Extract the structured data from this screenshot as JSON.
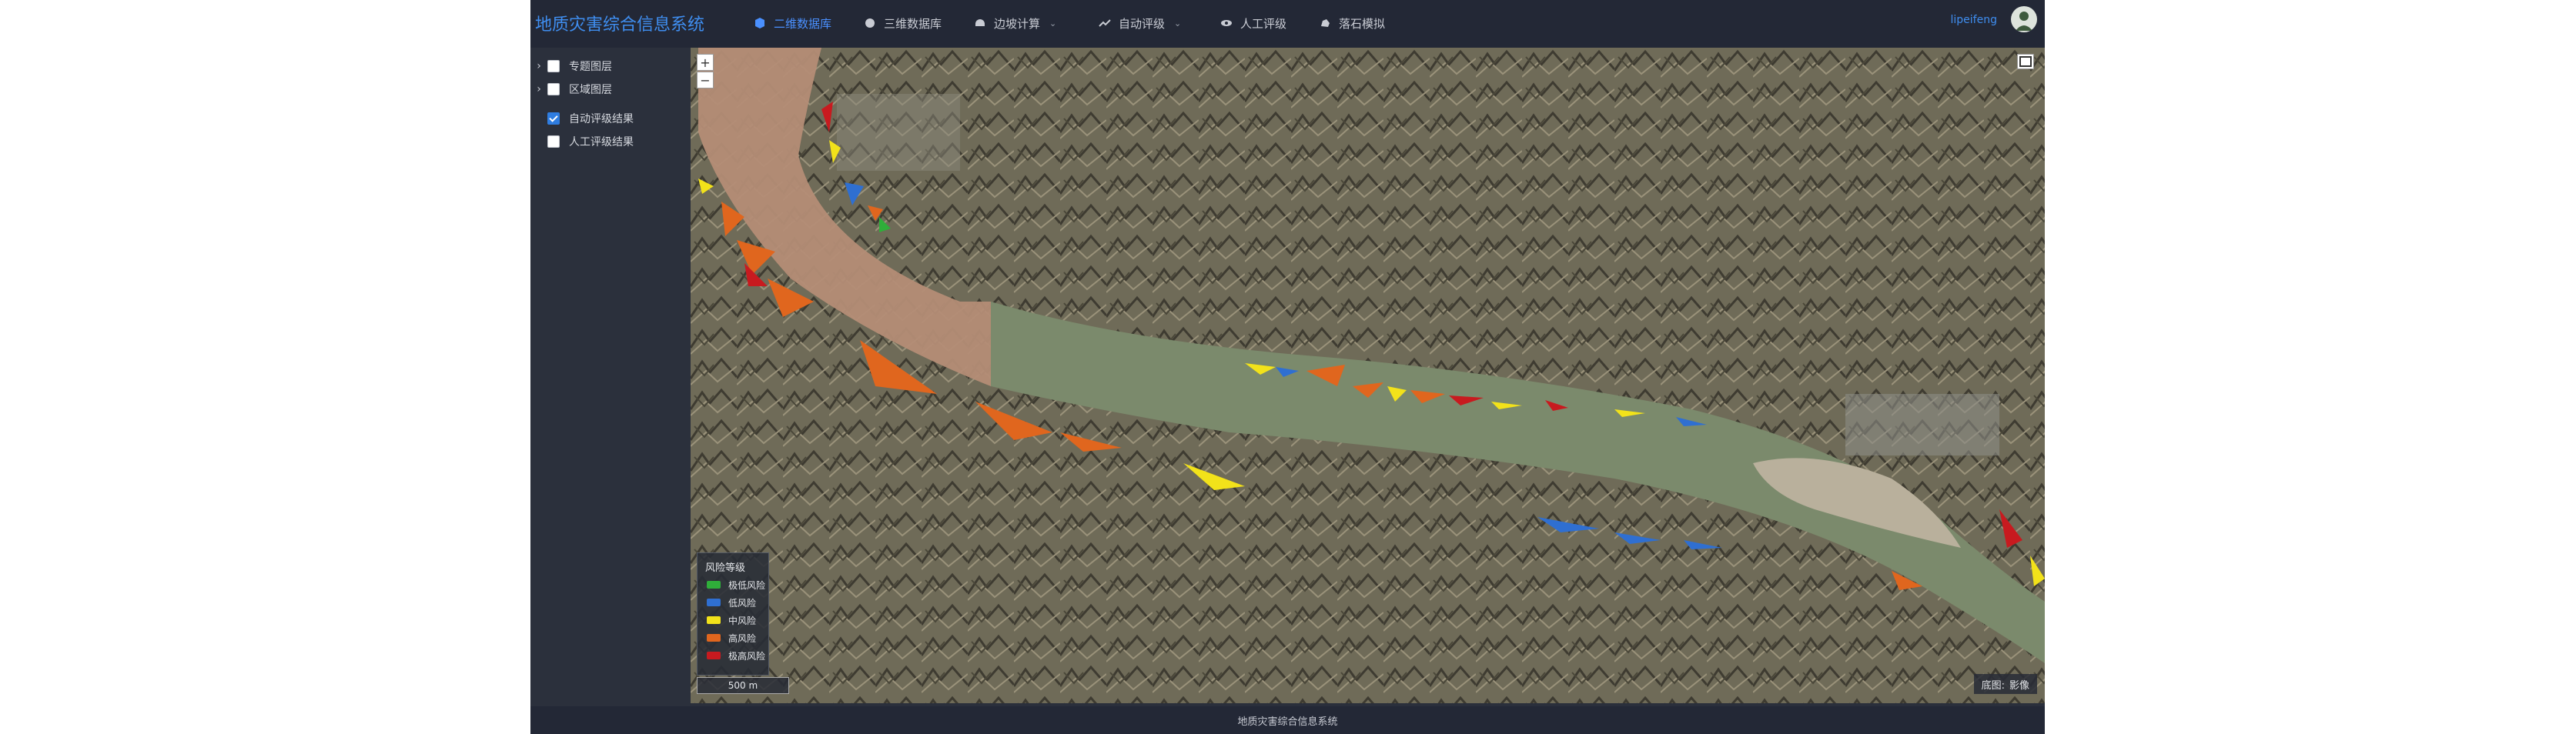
{
  "app": {
    "title": "地质灾害综合信息系统"
  },
  "nav": {
    "items": [
      {
        "label": "二维数据库",
        "icon": "cube-icon",
        "active": true
      },
      {
        "label": "三维数据库",
        "icon": "globe-icon"
      },
      {
        "label": "边坡计算",
        "icon": "calculator-icon",
        "dropdown": true
      },
      {
        "label": "自动评级",
        "icon": "trend-icon",
        "dropdown": true
      },
      {
        "label": "人工评级",
        "icon": "eye-icon"
      },
      {
        "label": "落石模拟",
        "icon": "rock-icon"
      }
    ]
  },
  "user": {
    "name": "lipeifeng",
    "avatar_icon": "user-avatar-icon"
  },
  "sidebar": {
    "layers": [
      {
        "label": "专题图层",
        "checked": false,
        "expandable": true
      },
      {
        "label": "区域图层",
        "checked": false,
        "expandable": true
      },
      {
        "label": "自动评级结果",
        "checked": true,
        "expandable": false
      },
      {
        "label": "人工评级结果",
        "checked": false,
        "expandable": false
      }
    ]
  },
  "map": {
    "zoom_in": "+",
    "zoom_out": "−",
    "scale": "500 m",
    "basemap_label": "底图:",
    "basemap_value": "影像",
    "legend": {
      "title": "风险等级",
      "items": [
        {
          "label": "极低风险",
          "color": "#2fae3a"
        },
        {
          "label": "低风险",
          "color": "#2f6fd1"
        },
        {
          "label": "中风险",
          "color": "#f2e21a"
        },
        {
          "label": "高风险",
          "color": "#e0661e"
        },
        {
          "label": "极高风险",
          "color": "#c81a1f"
        }
      ]
    }
  },
  "footer": {
    "text": "地质灾害综合信息系统"
  }
}
